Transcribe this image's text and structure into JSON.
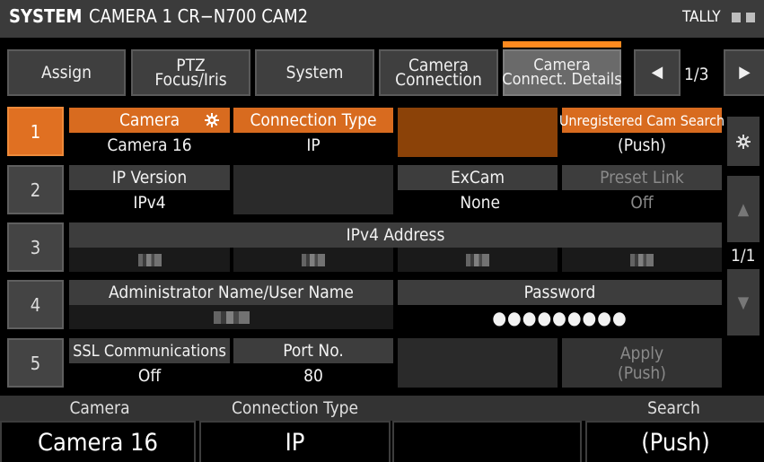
{
  "header": {
    "system_label": "SYSTEM",
    "title": "CAMERA 1  CR−N700 CAM2",
    "tally_label": "TALLY"
  },
  "tabs": [
    {
      "label": "Assign"
    },
    {
      "label": "PTZ\nFocus/Iris"
    },
    {
      "label": "System"
    },
    {
      "label": "Camera\nConnection"
    },
    {
      "label": "Camera\nConnect. Details"
    }
  ],
  "pager": {
    "prev_icon": "◀",
    "text": "1/3",
    "next_icon": "▶"
  },
  "rows": [
    "1",
    "2",
    "3",
    "4",
    "5"
  ],
  "row1": {
    "camera_label": "Camera",
    "camera_value": "Camera 16",
    "conn_type_label": "Connection Type",
    "conn_type_value": "IP",
    "unreg_label": "Unregistered Cam Search",
    "unreg_value": "(Push)"
  },
  "row2": {
    "ip_version_label": "IP Version",
    "ip_version_value": "IPv4",
    "excam_label": "ExCam",
    "excam_value": "None",
    "preset_label": "Preset Link",
    "preset_value": "Off"
  },
  "row3": {
    "ipv4_label": "IPv4 Address"
  },
  "row4": {
    "admin_label": "Administrator Name/User Name",
    "password_label": "Password",
    "password_value": "●●●●●●●●●"
  },
  "row5": {
    "ssl_label": "SSL Communications",
    "ssl_value": "Off",
    "port_label": "Port No.",
    "port_value": "80",
    "apply_label": "Apply",
    "apply_value": "(Push)"
  },
  "side": {
    "page": "1/1",
    "up_icon": "▲",
    "down_icon": "▼"
  },
  "bottom": {
    "camera_label": "Camera",
    "camera_value": "Camera 16",
    "conn_label": "Connection Type",
    "conn_value": "IP",
    "search_label": "Search",
    "search_value": "(Push)"
  },
  "colors": {
    "accent": "#e07022",
    "background": "#000000",
    "panel": "#3d3d3d"
  },
  "icons": {
    "camera_settings": "gear-icon",
    "side_settings": "gear-icon"
  }
}
